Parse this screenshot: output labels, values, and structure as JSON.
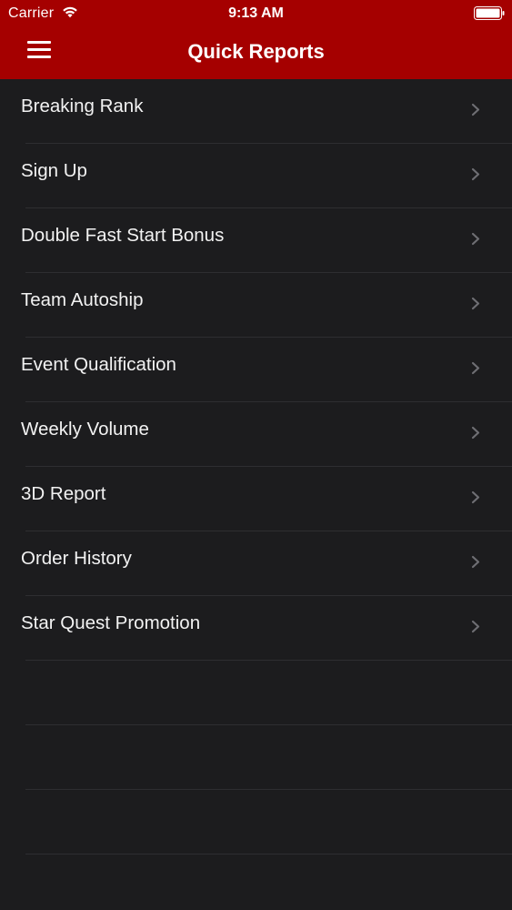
{
  "status_bar": {
    "carrier": "Carrier",
    "time": "9:13 AM",
    "wifi_icon": "wifi-icon",
    "battery_icon": "battery-icon"
  },
  "nav_bar": {
    "title": "Quick Reports",
    "menu_icon": "hamburger-menu-icon",
    "background_color": "#a50000"
  },
  "reports": {
    "items": [
      {
        "label": "Breaking Rank"
      },
      {
        "label": "Sign Up"
      },
      {
        "label": "Double Fast Start Bonus"
      },
      {
        "label": "Team Autoship"
      },
      {
        "label": "Event Qualification"
      },
      {
        "label": "Weekly Volume"
      },
      {
        "label": "3D Report"
      },
      {
        "label": "Order History"
      },
      {
        "label": "Star Quest Promotion"
      }
    ],
    "item_icon": "chevron-right-icon"
  },
  "colors": {
    "background": "#1c1c1e",
    "accent": "#a50000",
    "text": "#f2f2f2",
    "chevron": "#6e6e73"
  }
}
